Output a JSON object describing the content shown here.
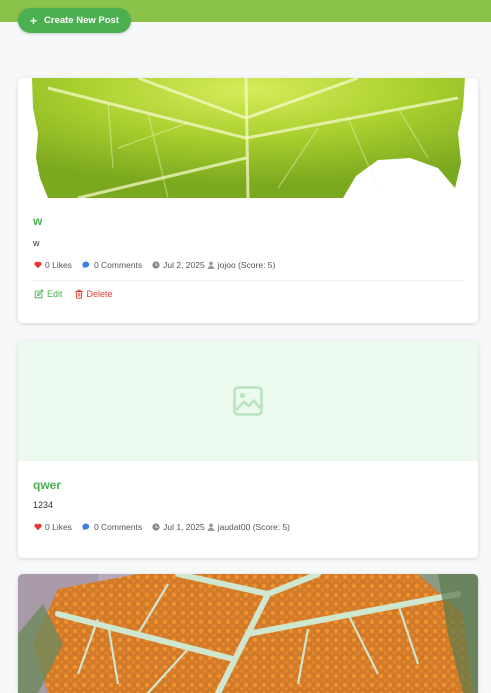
{
  "header": {
    "create_label": "Create New Post"
  },
  "posts": [
    {
      "title": "w",
      "body": "w",
      "likes": "0 Likes",
      "comments": "0 Comments",
      "date": "Jul 2, 2025",
      "author": "jojoo (Score: 5)",
      "edit_label": "Edit",
      "delete_label": "Delete"
    },
    {
      "title": "qwer",
      "body": "1234",
      "likes": "0 Likes",
      "comments": "0 Comments",
      "date": "Jul 1, 2025",
      "author": "jaudat00 (Score: 5)"
    }
  ],
  "colors": {
    "accent": "#4caf50",
    "topbar": "#8bc34a",
    "like": "#e53935",
    "comment": "#3f7fdb",
    "delete": "#e53935",
    "placeholder_bg": "#ecf9ee",
    "placeholder_icon": "#b7e3c1"
  }
}
